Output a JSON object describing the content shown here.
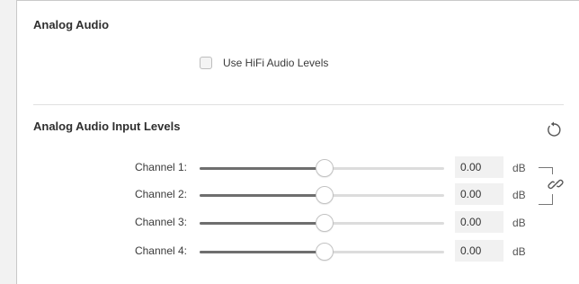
{
  "sections": {
    "analog_audio": {
      "title": "Analog Audio",
      "hifi_checkbox": {
        "label": "Use HiFi Audio Levels",
        "checked": false
      }
    },
    "input_levels": {
      "title": "Analog Audio Input Levels",
      "reset_icon": "reset-icon",
      "link_icon": "link-icon",
      "channels": [
        {
          "label": "Channel 1:",
          "value": "0.00",
          "unit": "dB",
          "level": 0.51
        },
        {
          "label": "Channel 2:",
          "value": "0.00",
          "unit": "dB",
          "level": 0.51
        },
        {
          "label": "Channel 3:",
          "value": "0.00",
          "unit": "dB",
          "level": 0.51
        },
        {
          "label": "Channel 4:",
          "value": "0.00",
          "unit": "dB",
          "level": 0.51
        }
      ]
    }
  },
  "colors": {
    "panel_bg": "#ffffff",
    "page_bg": "#f2f2f2",
    "slider_fill": "#6e6e6e",
    "slider_track": "#dcdcdc"
  }
}
